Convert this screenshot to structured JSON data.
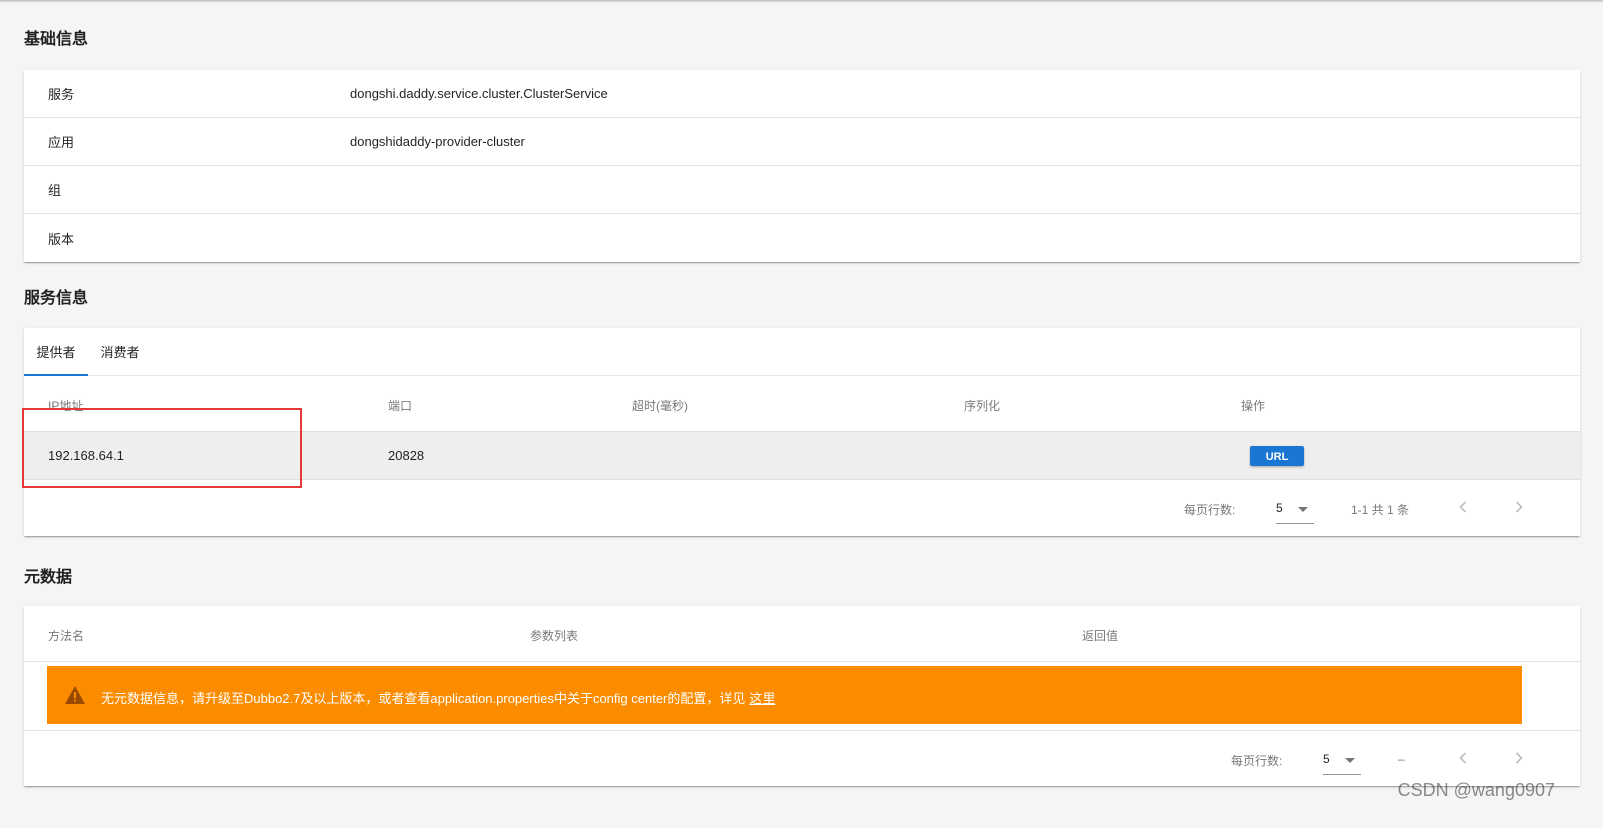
{
  "sections": {
    "basic_title": "基础信息",
    "service_title": "服务信息",
    "metadata_title": "元数据"
  },
  "basic_info": [
    {
      "key": "服务",
      "value": "dongshi.daddy.service.cluster.ClusterService"
    },
    {
      "key": "应用",
      "value": "dongshidaddy-provider-cluster"
    },
    {
      "key": "组",
      "value": ""
    },
    {
      "key": "版本",
      "value": ""
    }
  ],
  "tabs": [
    {
      "label": "提供者",
      "active": true
    },
    {
      "label": "消费者",
      "active": false
    }
  ],
  "provider_table": {
    "headers": [
      "IP地址",
      "端口",
      "超时(毫秒)",
      "序列化",
      "操作"
    ],
    "rows": [
      {
        "ip": "192.168.64.1",
        "port": "20828",
        "timeout": "",
        "serialization": "",
        "action": "URL"
      }
    ],
    "footer": {
      "rows_per_page_label": "每页行数:",
      "rows_per_page": "5",
      "range": "1-1 共 1 条"
    }
  },
  "metadata_table": {
    "headers": [
      "方法名",
      "参数列表",
      "返回值"
    ],
    "warning": {
      "text": "无元数据信息，请升级至Dubbo2.7及以上版本，或者查看application.properties中关于config center的配置，详见",
      "link": "这里",
      "color": "#fb8c00"
    },
    "footer": {
      "rows_per_page_label": "每页行数:",
      "rows_per_page": "5",
      "range": "–"
    }
  },
  "watermark": "CSDN @wang0907",
  "colors": {
    "primary": "#1976d2",
    "highlight": "#e53935",
    "warning": "#fb8c00"
  }
}
